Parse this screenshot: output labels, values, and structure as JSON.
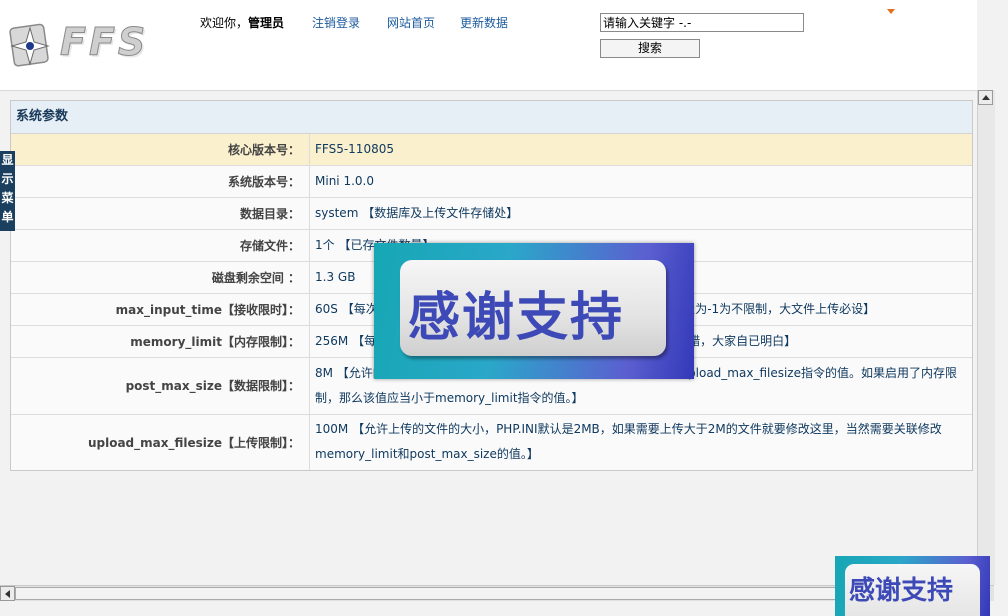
{
  "header": {
    "logo_text": "FFS",
    "welcome_prefix": "欢迎你，",
    "welcome_user": "管理员",
    "nav": [
      "注销登录",
      "网站首页",
      "更新数据"
    ],
    "search_placeholder": "请输入关键字 -.-",
    "search_button": "搜索"
  },
  "side_tab": {
    "label": "显示菜单"
  },
  "panel": {
    "title": "系统参数",
    "rows": [
      {
        "label": "核心版本号：",
        "value": "FFS5-110805",
        "highlight": true
      },
      {
        "label": "系统版本号：",
        "value": "Mini 1.0.0"
      },
      {
        "label": "数据目录：",
        "value": "system 【数据库及上传文件存储处】"
      },
      {
        "label": "存储文件：",
        "value": "1个 【已存文件数量】"
      },
      {
        "label": "磁盘剩余空间 ：",
        "value": "1.3 GB"
      },
      {
        "label": "max_input_time【接收限时】：",
        "value": "60S 【每次_PHP脚本解析输入数据允许的最长时间，单位是秒，可设置为-1为不限制，大文件上传必设】"
      },
      {
        "label": "memory_limit【内存限制】：",
        "value": "256M 【每个脚本能够使用的最大内存量，这个值过小上传大文件会出错，大家自已明白】"
      },
      {
        "label": "post_max_size【数据限制】：",
        "value": "8M 【允许的POST数据大小，如果需要上传较大文件，该值必须大于upload_max_filesize指令的值。如果启用了内存限制，那么该值应当小于memory_limit指令的值。】"
      },
      {
        "label": "upload_max_filesize【上传限制】：",
        "value": "100M 【允许上传的文件的大小，PHP.INI默认是2MB，如果需要上传大于2M的文件就要修改这里，当然需要关联修改memory_limit和post_max_size的值。】"
      }
    ]
  },
  "promo": {
    "text": "感谢支持"
  },
  "colors": {
    "accent": "#1b5a9c",
    "highlight_row": "#fbf0cd",
    "side_tab": "#1b3f5e"
  },
  "icons": [
    "ffs-logo-icon",
    "dropdown-arrow-icon",
    "scroll-up-icon",
    "scroll-left-icon"
  ]
}
